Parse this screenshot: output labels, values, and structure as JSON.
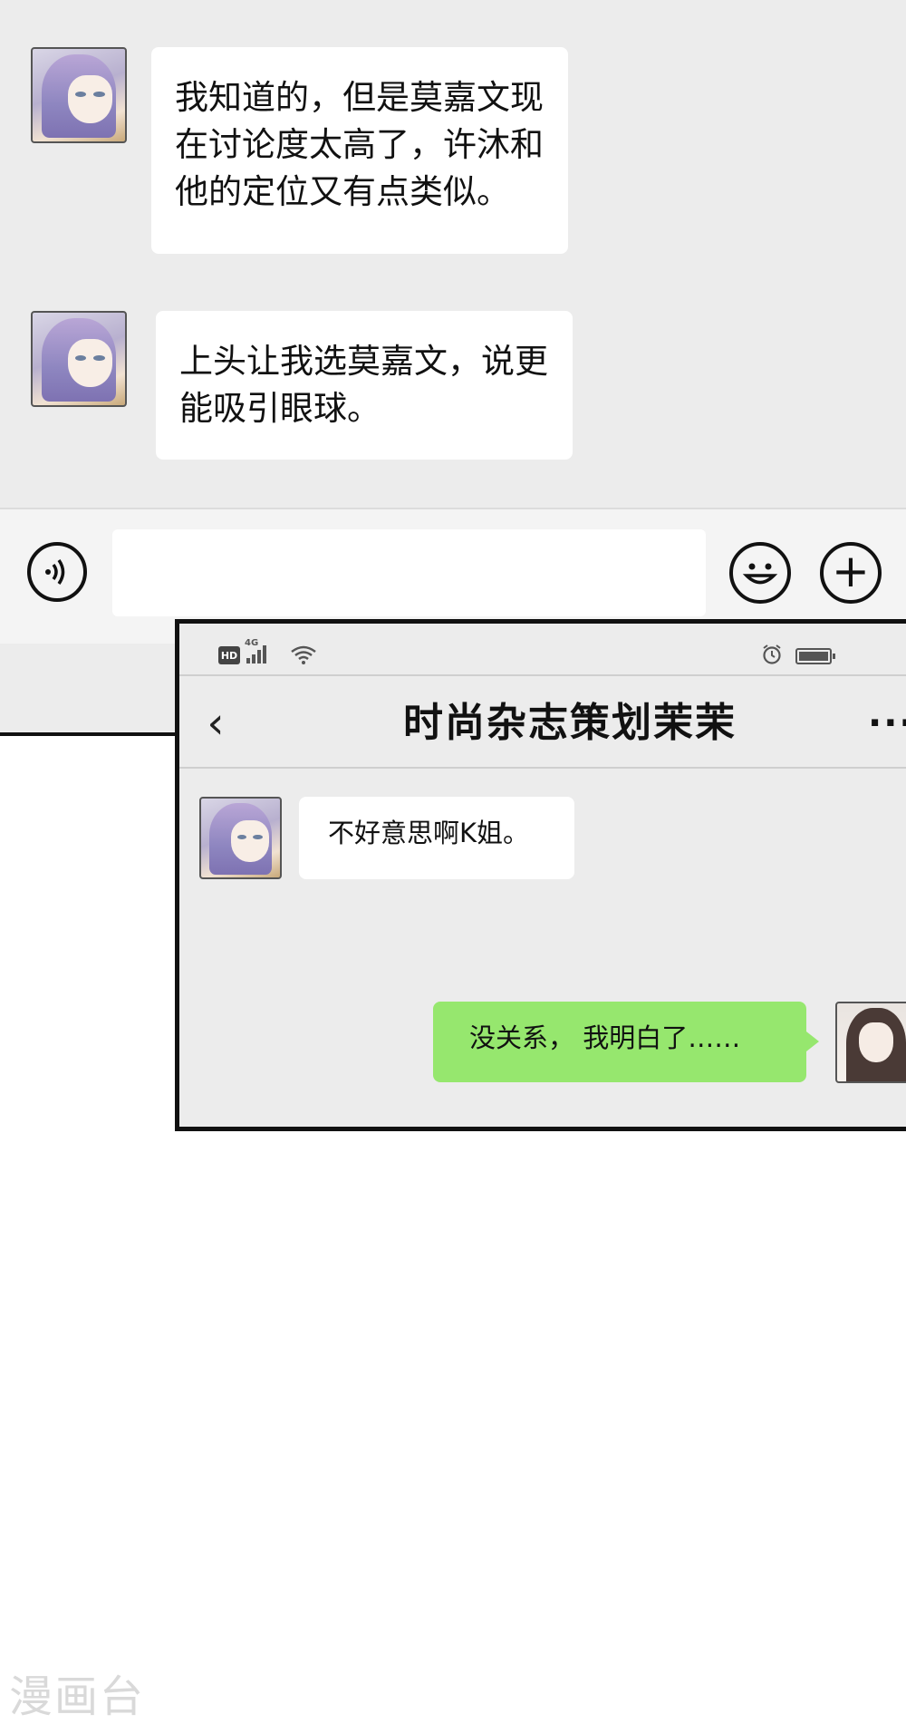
{
  "top_chat": {
    "messages": [
      {
        "sender": "contact",
        "text": "我知道的，但是莫嘉文现\n在讨论度太高了，许沐和\n他的定位又有点类似。"
      },
      {
        "sender": "contact",
        "text": "上头让我选莫嘉文，说更\n能吸引眼球。"
      }
    ],
    "input_bar": {
      "voice_icon": "voice-icon",
      "emoji_icon": "emoji-icon",
      "plus_icon": "plus-icon",
      "plus_glyph": "+"
    }
  },
  "phone": {
    "status_bar": {
      "hd": "HD",
      "network": "4G"
    },
    "nav": {
      "back_glyph": "‹",
      "title": "时尚杂志策划茉茉",
      "more_glyph": "···"
    },
    "messages": [
      {
        "sender": "contact",
        "text": "不好意思啊K姐。"
      },
      {
        "sender": "self",
        "text": "没关系， 我明白了……"
      }
    ]
  },
  "watermark": "漫画台",
  "colors": {
    "chat_background": "#ececec",
    "incoming_bubble": "#ffffff",
    "outgoing_bubble": "#96e76e",
    "border": "#111111"
  }
}
